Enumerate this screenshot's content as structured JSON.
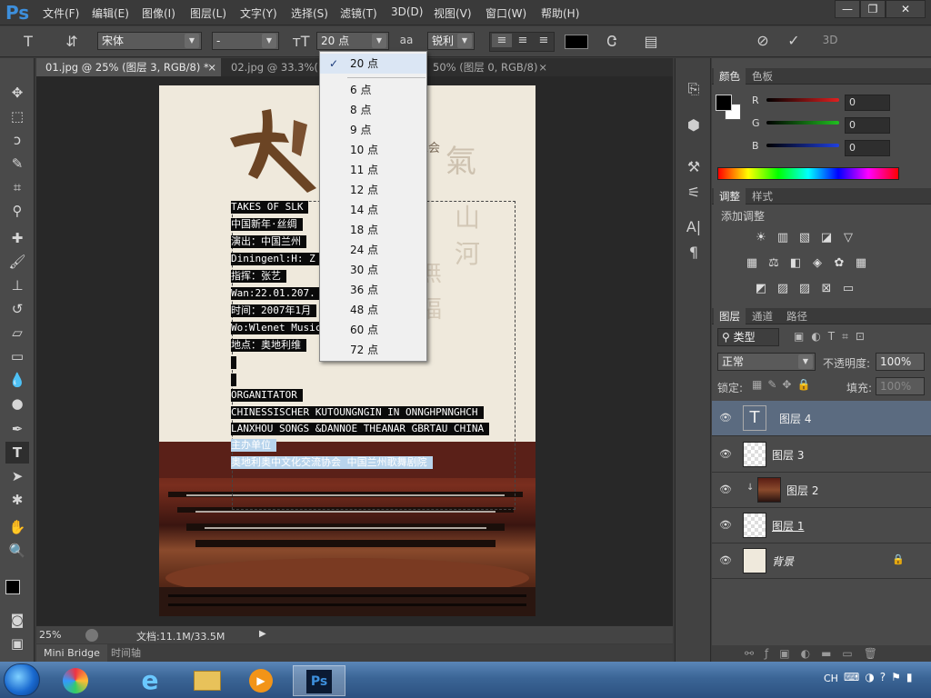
{
  "app": {
    "logo": "Ps"
  },
  "menu": [
    "文件(F)",
    "编辑(E)",
    "图像(I)",
    "图层(L)",
    "文字(Y)",
    "选择(S)",
    "滤镜(T)",
    "3D(D)",
    "视图(V)",
    "窗口(W)",
    "帮助(H)"
  ],
  "window_controls": {
    "minimize": "—",
    "restore": "❐",
    "close": "✕"
  },
  "options_bar": {
    "font_family": "宋体",
    "font_style": "-",
    "font_size": "20 点",
    "anti_alias_icon": "aa",
    "anti_alias": "锐利",
    "text_color": "#000000"
  },
  "doc_tabs": [
    {
      "label": "01.jpg @ 25% (图层 3, RGB/8) *",
      "close": "×"
    },
    {
      "label": "02.jpg @ 33.3%(R",
      "close": ""
    },
    {
      "label": "50% (图层 0, RGB/8)",
      "close": "×"
    }
  ],
  "font_size_dropdown": {
    "selected": "20 点",
    "options": [
      "6 点",
      "8 点",
      "9 点",
      "10 点",
      "11 点",
      "12 点",
      "14 点",
      "18 点",
      "24 点",
      "30 点",
      "36 点",
      "48 点",
      "60 点",
      "72 点"
    ]
  },
  "document": {
    "subtitle": "乐会",
    "lines": [
      "TAKES  OF  SLK",
      "中国新年·丝绸",
      "演出：中国兰州",
      "Diningenl:H: Z",
      "指挥：张艺",
      "Wan:22.01.207.",
      "时间：2007年1月",
      "Wo:Wlenet Music                   ol",
      "地点：奥地利维",
      "",
      "",
      "ORGANITATOR",
      "CHINESSISCHER KUTOUNGNGIN IN ONNGHPNNGHCH",
      "LANXHOU SONGS &DANNOE THEANAR GBRTAU CHINA",
      "主办单位",
      "奥地利奥中文化交流协会  中国兰州歌舞剧院"
    ]
  },
  "status_bar": {
    "zoom": "25%",
    "doc_info": "文档:11.1M/33.5M"
  },
  "bottom_tabs": [
    "Mini Bridge",
    "时间轴"
  ],
  "color_panel": {
    "tabs": [
      "颜色",
      "色板"
    ],
    "channels": [
      {
        "label": "R",
        "value": "0",
        "color": "#e02020"
      },
      {
        "label": "G",
        "value": "0",
        "color": "#20c020"
      },
      {
        "label": "B",
        "value": "0",
        "color": "#2040e0"
      }
    ]
  },
  "adjust_panel": {
    "tabs": [
      "调整",
      "样式"
    ],
    "title": "添加调整"
  },
  "layers_panel": {
    "tabs": [
      "图层",
      "通道",
      "路径"
    ],
    "filter_label": "类型",
    "blend_mode": "正常",
    "opacity_label": "不透明度:",
    "opacity": "100%",
    "lock_label": "锁定:",
    "fill_label": "填充:",
    "fill": "100%",
    "layers": [
      {
        "name": "图层 4",
        "type": "text",
        "selected": true
      },
      {
        "name": "图层 3",
        "type": "pixel",
        "selected": false
      },
      {
        "name": "图层 2",
        "type": "photo",
        "selected": false
      },
      {
        "name": "图层 1",
        "type": "pixel",
        "selected": false
      },
      {
        "name": "背景",
        "type": "background",
        "selected": false
      }
    ]
  },
  "taskbar": {
    "tray_lang": "CH"
  },
  "colors": {
    "accent": "#3d8fdc",
    "selection": "#5b6b80",
    "foreground": "#000000",
    "background": "#ffffff"
  }
}
